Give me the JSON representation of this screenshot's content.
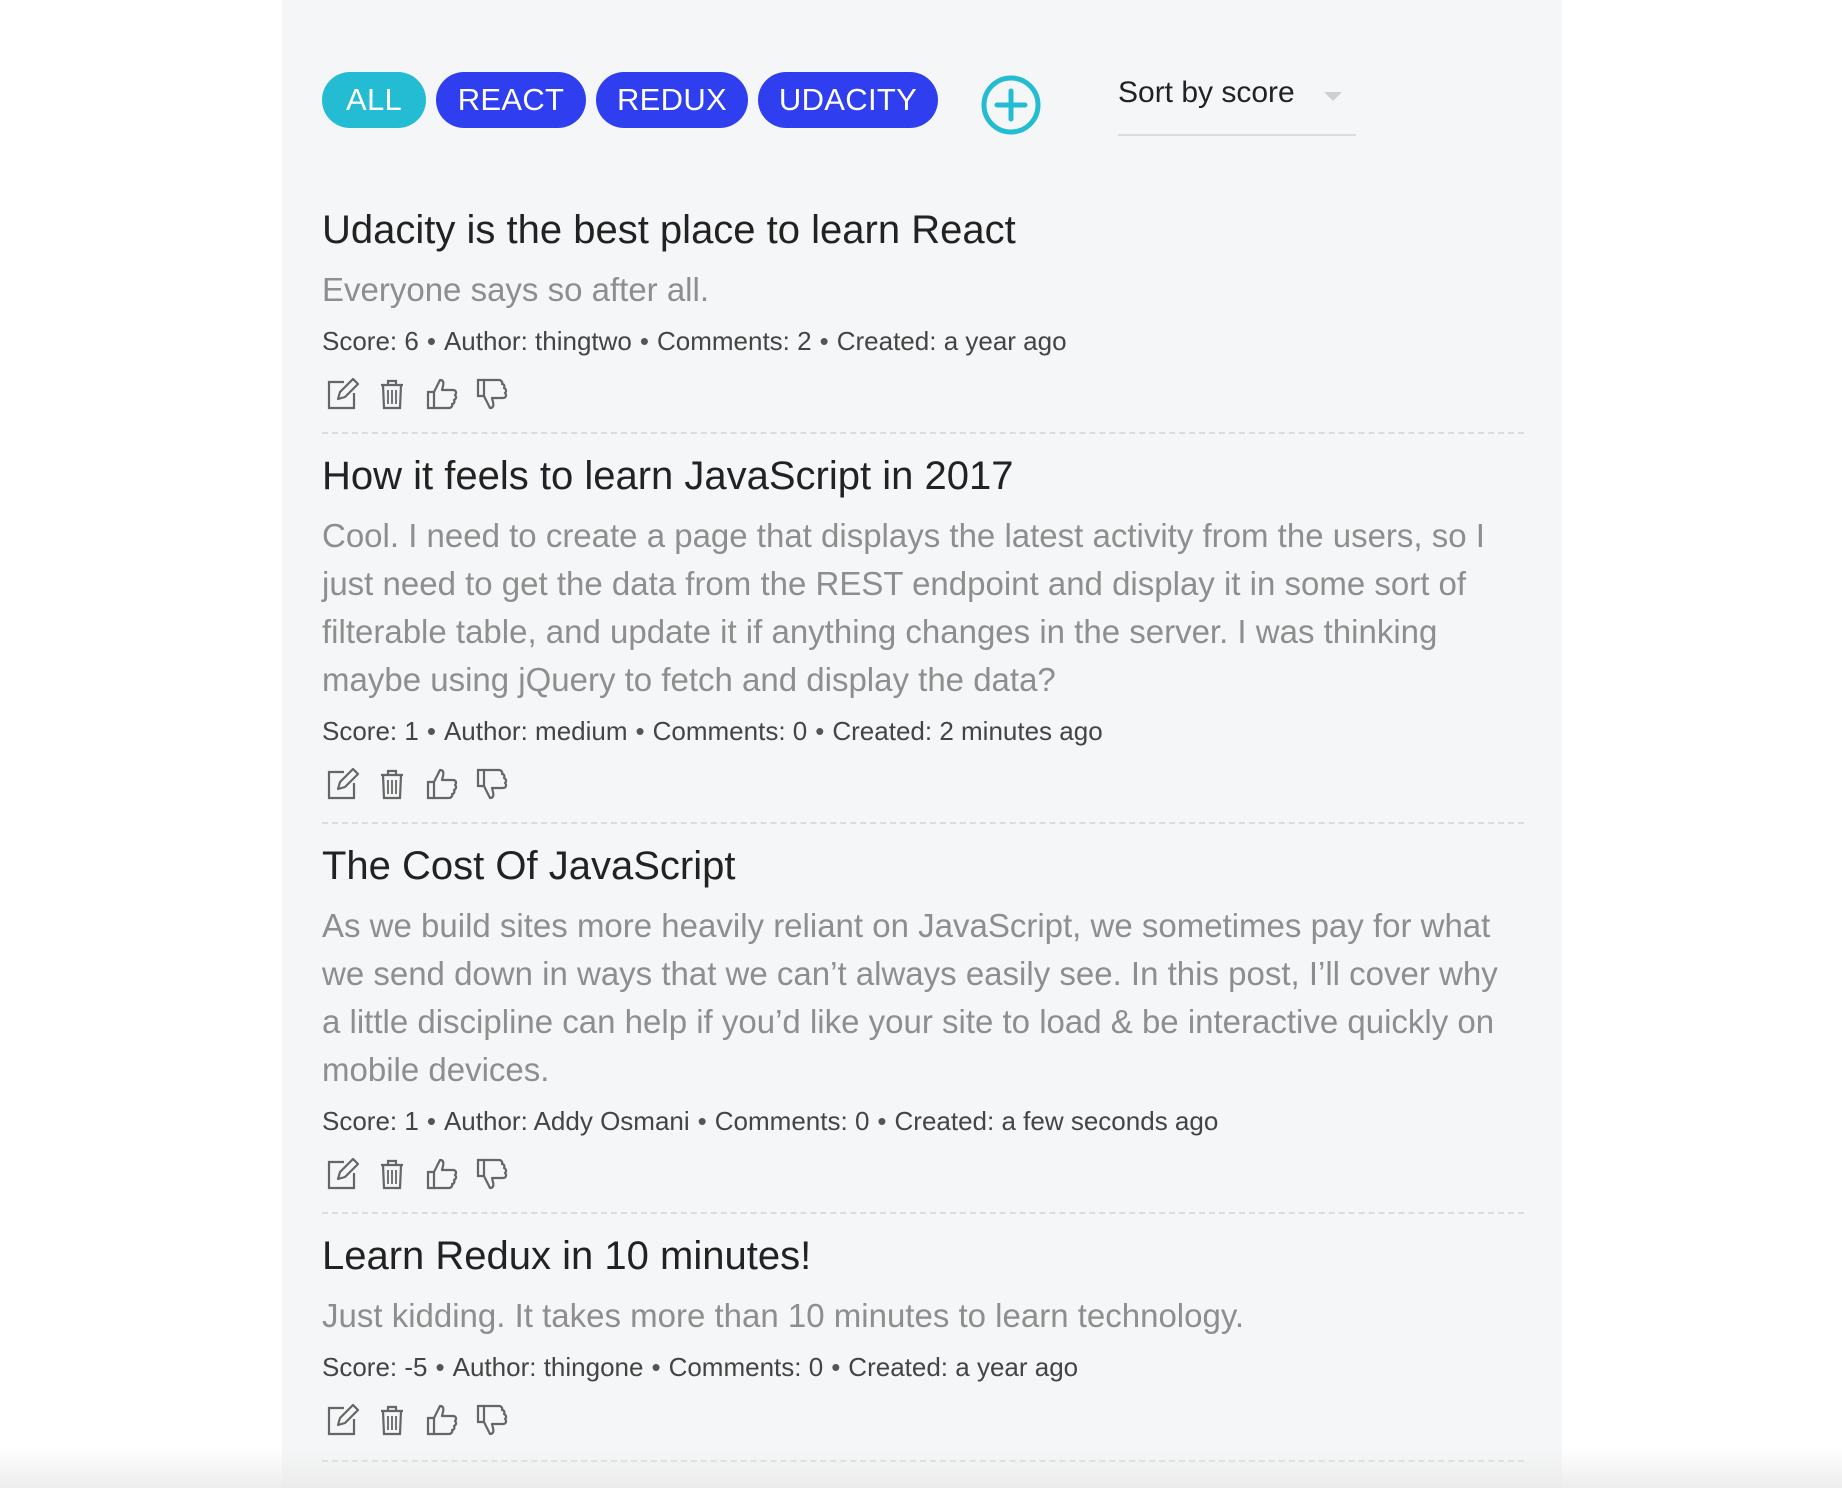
{
  "filters": {
    "categories": [
      {
        "label": "ALL",
        "active": true
      },
      {
        "label": "REACT",
        "active": false
      },
      {
        "label": "REDUX",
        "active": false
      },
      {
        "label": "UDACITY",
        "active": false
      }
    ],
    "add_icon": "plus-circle-icon",
    "sort_label": "Sort by score"
  },
  "meta_labels": {
    "score": "Score:",
    "author": "Author:",
    "comments": "Comments:",
    "created": "Created:",
    "separator": "•"
  },
  "posts": [
    {
      "title": "Udacity is the best place to learn React",
      "body": "Everyone says so after all.",
      "score": "6",
      "author": "thingtwo",
      "comments": "2",
      "created": "a year ago"
    },
    {
      "title": "How it feels to learn JavaScript in 2017",
      "body": "Cool. I need to create a page that displays the latest activity from the users, so I just need to get the data from the REST endpoint and display it in some sort of filterable table, and update it if anything changes in the server. I was thinking maybe using jQuery to fetch and display the data?",
      "score": "1",
      "author": "medium",
      "comments": "0",
      "created": "2 minutes ago"
    },
    {
      "title": "The Cost Of JavaScript",
      "body": "As we build sites more heavily reliant on JavaScript, we sometimes pay for what we send down in ways that we can’t always easily see. In this post, I’ll cover why a little discipline can help if you’d like your site to load & be interactive quickly on mobile devices.",
      "score": "1",
      "author": "Addy Osmani",
      "comments": "0",
      "created": "a few seconds ago"
    },
    {
      "title": "Learn Redux in 10 minutes!",
      "body": "Just kidding. It takes more than 10 minutes to learn technology.",
      "score": "-5",
      "author": "thingone",
      "comments": "0",
      "created": "a year ago"
    }
  ],
  "action_icons": [
    "edit-icon",
    "trash-icon",
    "thumbs-up-icon",
    "thumbs-down-icon"
  ],
  "colors": {
    "chip_active": "#23bcd3",
    "chip_tag": "#2f3ff0",
    "add_button": "#23bcd3",
    "title": "#222222",
    "body": "#8e8e8e"
  }
}
